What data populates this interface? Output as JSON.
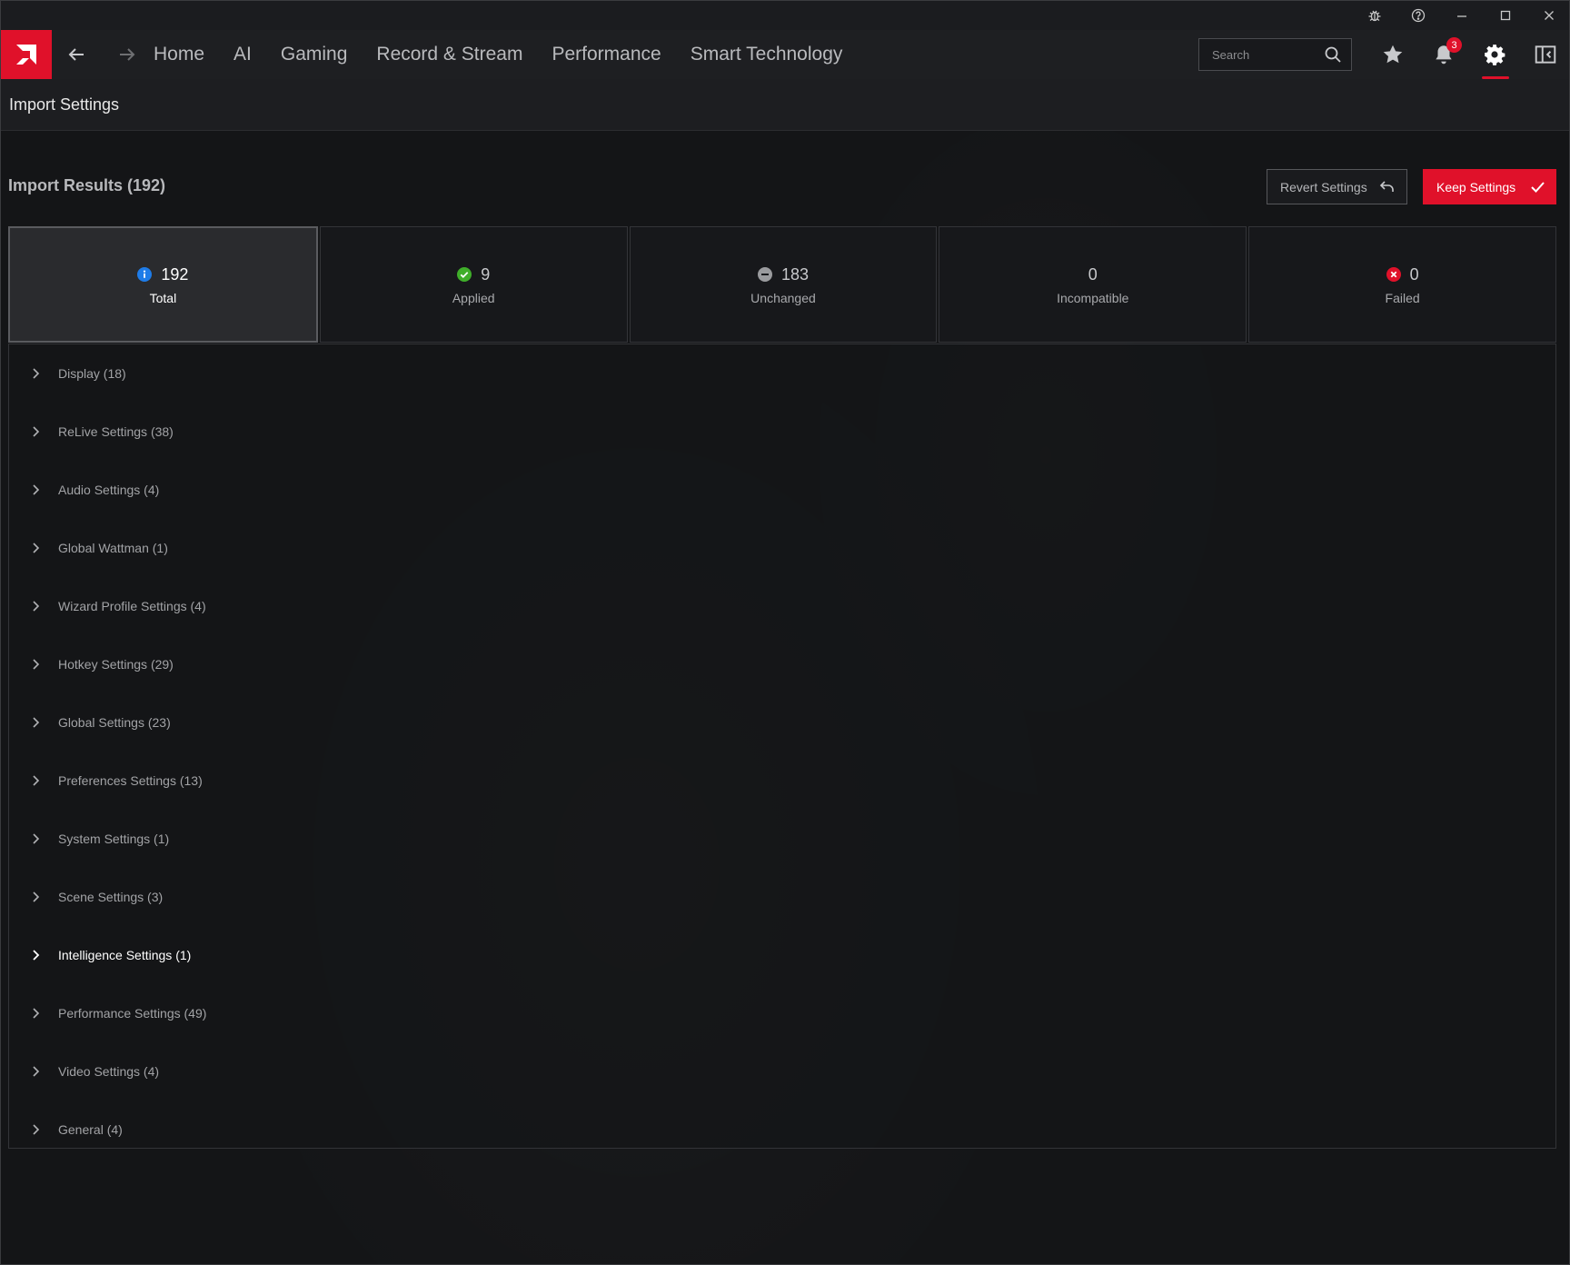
{
  "nav": {
    "links": [
      "Home",
      "AI",
      "Gaming",
      "Record & Stream",
      "Performance",
      "Smart Technology"
    ],
    "search_placeholder": "Search",
    "notification_count": "3"
  },
  "page": {
    "title": "Import Settings"
  },
  "results": {
    "title": "Import Results (192)",
    "revert_label": "Revert Settings",
    "keep_label": "Keep Settings"
  },
  "stats": [
    {
      "value": "192",
      "label": "Total",
      "icon": "info-icon",
      "color": "#1e7ce8"
    },
    {
      "value": "9",
      "label": "Applied",
      "icon": "check-circle-icon",
      "color": "#3fae2a"
    },
    {
      "value": "183",
      "label": "Unchanged",
      "icon": "minus-circle-icon",
      "color": "#9a9b9e"
    },
    {
      "value": "0",
      "label": "Incompatible",
      "icon": "",
      "color": ""
    },
    {
      "value": "0",
      "label": "Failed",
      "icon": "x-circle-icon",
      "color": "#e0112a"
    }
  ],
  "categories": [
    "Display (18)",
    "ReLive Settings (38)",
    "Audio Settings (4)",
    "Global Wattman (1)",
    "Wizard Profile Settings (4)",
    "Hotkey Settings (29)",
    "Global Settings (23)",
    "Preferences Settings (13)",
    "System Settings (1)",
    "Scene Settings (3)",
    "Intelligence Settings (1)",
    "Performance Settings (49)",
    "Video Settings (4)",
    "General (4)"
  ],
  "colors": {
    "accent": "#e0112a"
  }
}
